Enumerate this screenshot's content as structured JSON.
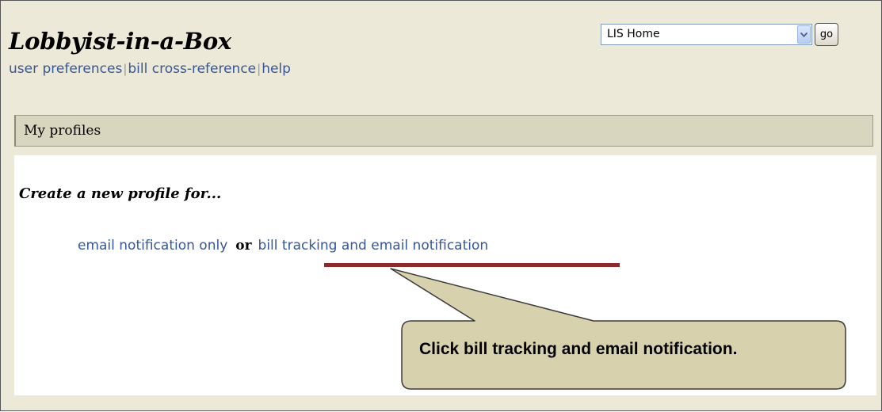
{
  "header": {
    "app_title": "Lobbyist-in-a-Box",
    "nav_links": [
      "user preferences",
      "bill cross-reference",
      "help"
    ],
    "site_select": {
      "selected": "LIS Home"
    },
    "go_label": "go"
  },
  "section": {
    "title": "My profiles"
  },
  "content": {
    "create_heading": "Create a new profile for...",
    "option_email": "email notification only",
    "or_label": "or",
    "option_tracking": "bill tracking and email notification"
  },
  "callout": {
    "text": "Click bill tracking and email notification."
  },
  "colors": {
    "page_bg": "#ece9d8",
    "link": "#36579a",
    "section_bar": "#d9d6c0",
    "underline": "#8b2a2a",
    "callout_fill": "#d8d1ad"
  }
}
